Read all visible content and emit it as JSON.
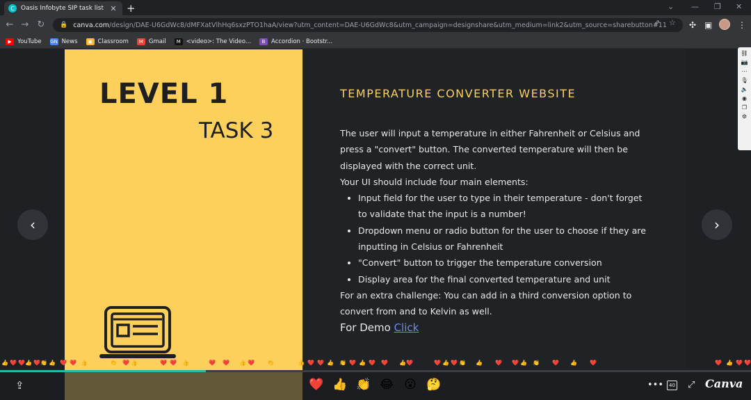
{
  "browser": {
    "tab_title": "Oasis Infobyte SIP task list",
    "tab_favicon": "C",
    "new_tab": "+",
    "close_tab": "✕",
    "url_host": "canva.com",
    "url_path": "/design/DAE-U6GdWc8/dMFXatVlhHq6sxzPTO1haA/view?utm_content=DAE-U6GdWc8&utm_campaign=designshare&utm_medium=link2&utm_source=sharebutton#11",
    "bookmarks": [
      {
        "label": "YouTube",
        "icon": "youtube-icon",
        "color": "#ff0000",
        "glyph": "▶"
      },
      {
        "label": "News",
        "icon": "news-icon",
        "color": "#4285f4",
        "glyph": "GN"
      },
      {
        "label": "Classroom",
        "icon": "classroom-icon",
        "color": "#f7b82a",
        "glyph": "▣"
      },
      {
        "label": "Gmail",
        "icon": "gmail-icon",
        "color": "#ea4335",
        "glyph": "M"
      },
      {
        "label": "<video>: The Video...",
        "icon": "mdn-icon",
        "color": "#111111",
        "glyph": "M"
      },
      {
        "label": "Accordion · Bootstr...",
        "icon": "bootstrap-icon",
        "color": "#7952b3",
        "glyph": "B"
      }
    ]
  },
  "slide": {
    "level": "LEVEL 1",
    "task": "TASK 3",
    "heading": "TEMPERATURE CONVERTER WEBSITE",
    "intro": "The user will input a temperature in either Fahrenheit or Celsius and press a \"convert\" button. The converted temperature will then be displayed with the correct unit.",
    "ui_intro": "Your UI should include four main elements:",
    "bullets": [
      "Input field for the user to type in their temperature - don't forget to validate that the input is a number!",
      "Dropdown menu or radio button for the user to choose if they are inputting in Celsius or Fahrenheit",
      "\"Convert\" button to trigger the temperature conversion",
      "Display area for the final converted temperature and unit"
    ],
    "challenge": "For an extra challenge: You can add in a third conversion option to convert from and to Kelvin as well.",
    "demo_label": "For Demo",
    "demo_link": "Click"
  },
  "nav": {
    "prev": "‹",
    "next": "›"
  },
  "progress": 0.274,
  "reactions": [
    "❤️",
    "👍",
    "👏",
    "😂",
    "😮",
    "🤔"
  ],
  "bottom": {
    "share": "⇪",
    "more": "•••",
    "zoom_badge": "40",
    "fullscreen": "⤢",
    "brand": "Canva"
  },
  "colors": {
    "slide_yellow": "#fdd05c",
    "slide_dark": "#1f2326",
    "accent_teal": "#2ab5a5",
    "link_blue": "#6c8ce8"
  }
}
